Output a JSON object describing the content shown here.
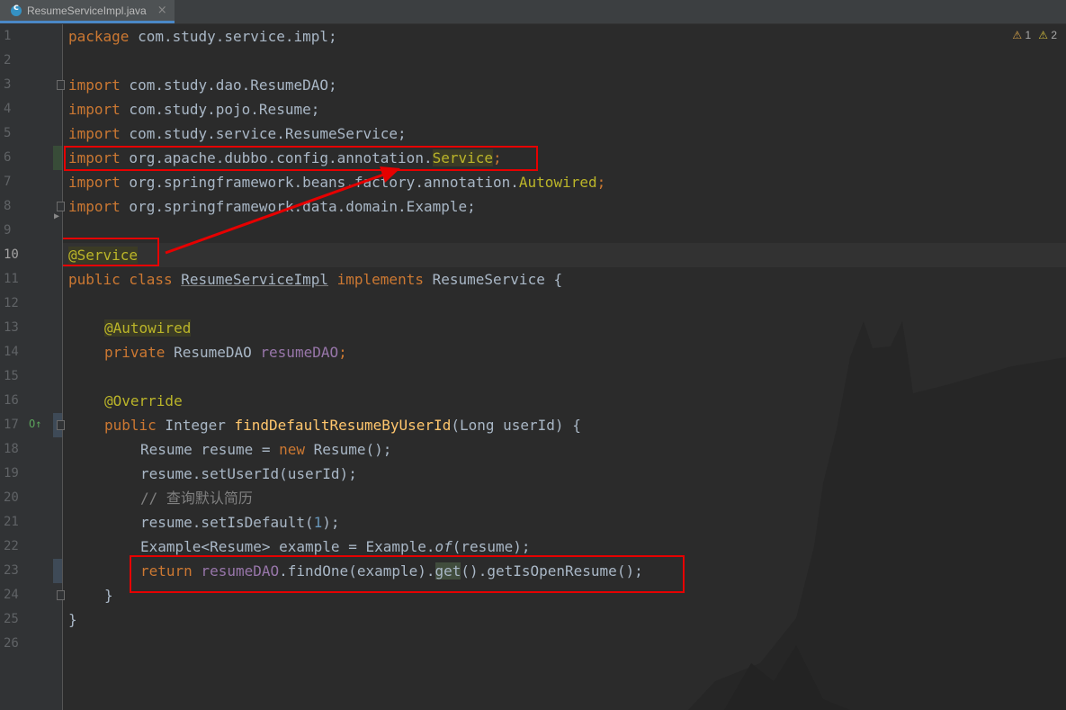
{
  "tab": {
    "title": "ResumeServiceImpl.java",
    "close": "×"
  },
  "warnings": {
    "warn_count": "1",
    "weak_count": "2"
  },
  "lines": [
    {
      "n": "1"
    },
    {
      "n": "2"
    },
    {
      "n": "3"
    },
    {
      "n": "4"
    },
    {
      "n": "5"
    },
    {
      "n": "6"
    },
    {
      "n": "7"
    },
    {
      "n": "8"
    },
    {
      "n": "9"
    },
    {
      "n": "10"
    },
    {
      "n": "11"
    },
    {
      "n": "12"
    },
    {
      "n": "13"
    },
    {
      "n": "14"
    },
    {
      "n": "15"
    },
    {
      "n": "16"
    },
    {
      "n": "17"
    },
    {
      "n": "18"
    },
    {
      "n": "19"
    },
    {
      "n": "20"
    },
    {
      "n": "21"
    },
    {
      "n": "22"
    },
    {
      "n": "23"
    },
    {
      "n": "24"
    },
    {
      "n": "25"
    },
    {
      "n": "26"
    }
  ],
  "code": {
    "l1_kw": "package",
    "l1_rest": " com.study.service.impl;",
    "l3_kw": "import",
    "l3_rest": " com.study.dao.ResumeDAO;",
    "l4_kw": "import",
    "l4_rest": " com.study.pojo.Resume;",
    "l5_kw": "import",
    "l5_rest": " com.study.service.ResumeService;",
    "l6_kw": "import",
    "l6_rest": " org.apache.dubbo.config.annotation.",
    "l6_cls": "Service",
    "l6_end": ";",
    "l7_kw": "import",
    "l7_rest": " org.springframework.beans.factory.annotation.",
    "l7_cls": "Autowired",
    "l7_end": ";",
    "l8_kw": "import",
    "l8_rest": " org.springframework.data.domain.Example;",
    "l10_ann": "@Service",
    "l11_kw1": "public",
    "l11_kw2": " class ",
    "l11_name": "ResumeServiceImpl",
    "l11_kw3": " implements",
    "l11_rest": " ResumeService {",
    "l13_ann": "@Autowired",
    "l14_kw": "private",
    "l14_type": " ResumeDAO ",
    "l14_field": "resumeDAO",
    "l14_end": ";",
    "l16_ann": "@Override",
    "l17_kw": "public",
    "l17_type": " Integer ",
    "l17_fn": "findDefaultResumeByUserId",
    "l17_rest": "(Long userId) {",
    "l18_a": "Resume resume = ",
    "l18_kw": "new",
    "l18_b": " Resume();",
    "l19": "resume.setUserId(userId);",
    "l20": "// 查询默认简历",
    "l21_a": "resume.setIsDefault(",
    "l21_num": "1",
    "l21_b": ");",
    "l22_a": "Example<Resume> example = Example.",
    "l22_it": "of",
    "l22_b": "(resume);",
    "l23_kw": "return",
    "l23_field": " resumeDAO",
    "l23_a": ".findOne(example).",
    "l23_get": "get",
    "l23_b": "().getIsOpenResume();",
    "l24": "}",
    "l25": "}"
  }
}
